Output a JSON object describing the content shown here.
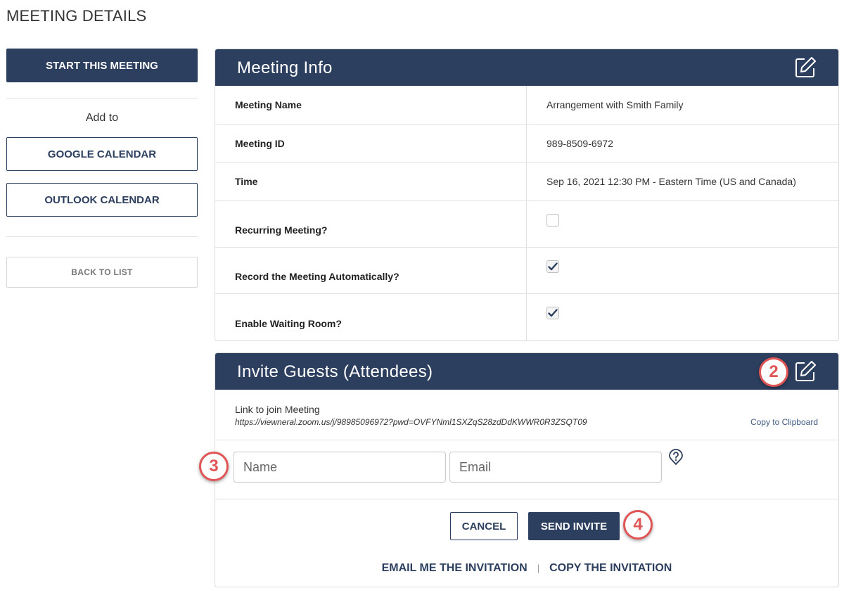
{
  "page": {
    "title": "MEETING DETAILS"
  },
  "sidebar": {
    "start_label": "START THIS MEETING",
    "add_to_label": "Add to",
    "google_label": "GOOGLE CALENDAR",
    "outlook_label": "OUTLOOK CALENDAR",
    "back_label": "BACK TO LIST"
  },
  "meeting_info": {
    "title": "Meeting Info",
    "edit_icon": "edit-icon",
    "rows": [
      {
        "label": "Meeting Name",
        "value": "Arrangement with Smith Family"
      },
      {
        "label": "Meeting ID",
        "value": "989-8509-6972"
      },
      {
        "label": "Time",
        "value": "Sep 16, 2021 12:30 PM - Eastern Time (US and Canada)"
      },
      {
        "label": "Recurring Meeting?",
        "checked": false
      },
      {
        "label": "Record the Meeting Automatically?",
        "checked": true
      },
      {
        "label": "Enable Waiting Room?",
        "checked": true
      }
    ]
  },
  "invite": {
    "title": "Invite Guests (Attendees)",
    "link_label": "Link to join Meeting",
    "link_url": "https://viewneral.zoom.us/j/98985096972?pwd=OVFYNml1SXZqS28zdDdKWWR0R3ZSQT09",
    "copy_label": "Copy to Clipboard",
    "name_placeholder": "Name",
    "email_placeholder": "Email",
    "cancel_label": "CANCEL",
    "send_label": "SEND INVITE",
    "email_me_label": "EMAIL ME THE INVITATION",
    "separator": "|",
    "copy_invitation_label": "COPY THE INVITATION"
  },
  "callouts": {
    "c2": "2",
    "c3": "3",
    "c4": "4"
  },
  "colors": {
    "primary": "#2d3f5f",
    "callout": "#e05555",
    "border": "#dcdcdc"
  }
}
